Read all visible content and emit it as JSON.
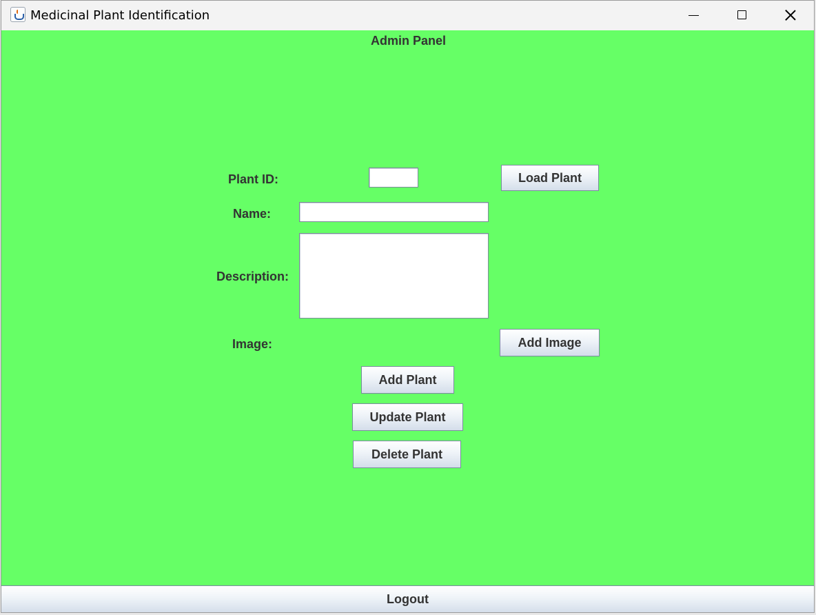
{
  "window": {
    "title": "Medicinal Plant Identification",
    "icon": "java-icon"
  },
  "panel": {
    "title": "Admin Panel",
    "labels": {
      "plant_id": "Plant ID:",
      "name": "Name:",
      "description": "Description:",
      "image": "Image:"
    },
    "fields": {
      "plant_id": "",
      "name": "",
      "description": ""
    },
    "buttons": {
      "load_plant": "Load Plant",
      "add_image": "Add Image",
      "add_plant": "Add Plant",
      "update_plant": "Update Plant",
      "delete_plant": "Delete Plant",
      "logout": "Logout"
    }
  },
  "colors": {
    "background": "#66ff66",
    "titlebar": "#f3f3f3"
  }
}
